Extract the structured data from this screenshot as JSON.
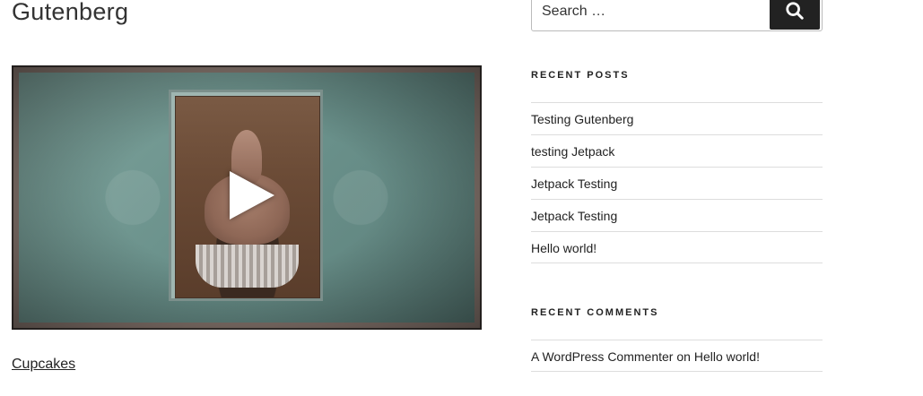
{
  "post": {
    "title": "Gutenberg",
    "video_link": "Cupcakes"
  },
  "sidebar": {
    "search": {
      "placeholder": "Search …",
      "button_icon": "search-icon"
    },
    "recent_posts": {
      "title": "Recent Posts",
      "items": [
        {
          "label": "Testing Gutenberg"
        },
        {
          "label": "testing Jetpack"
        },
        {
          "label": "Jetpack Testing"
        },
        {
          "label": "Jetpack Testing"
        },
        {
          "label": "Hello world!"
        }
      ]
    },
    "recent_comments": {
      "title": "Recent Comments",
      "items": [
        {
          "author": "A WordPress Commenter",
          "on": "on",
          "post": "Hello world!"
        }
      ]
    }
  },
  "colors": {
    "button_bg": "#222222",
    "border": "#dddddd"
  }
}
